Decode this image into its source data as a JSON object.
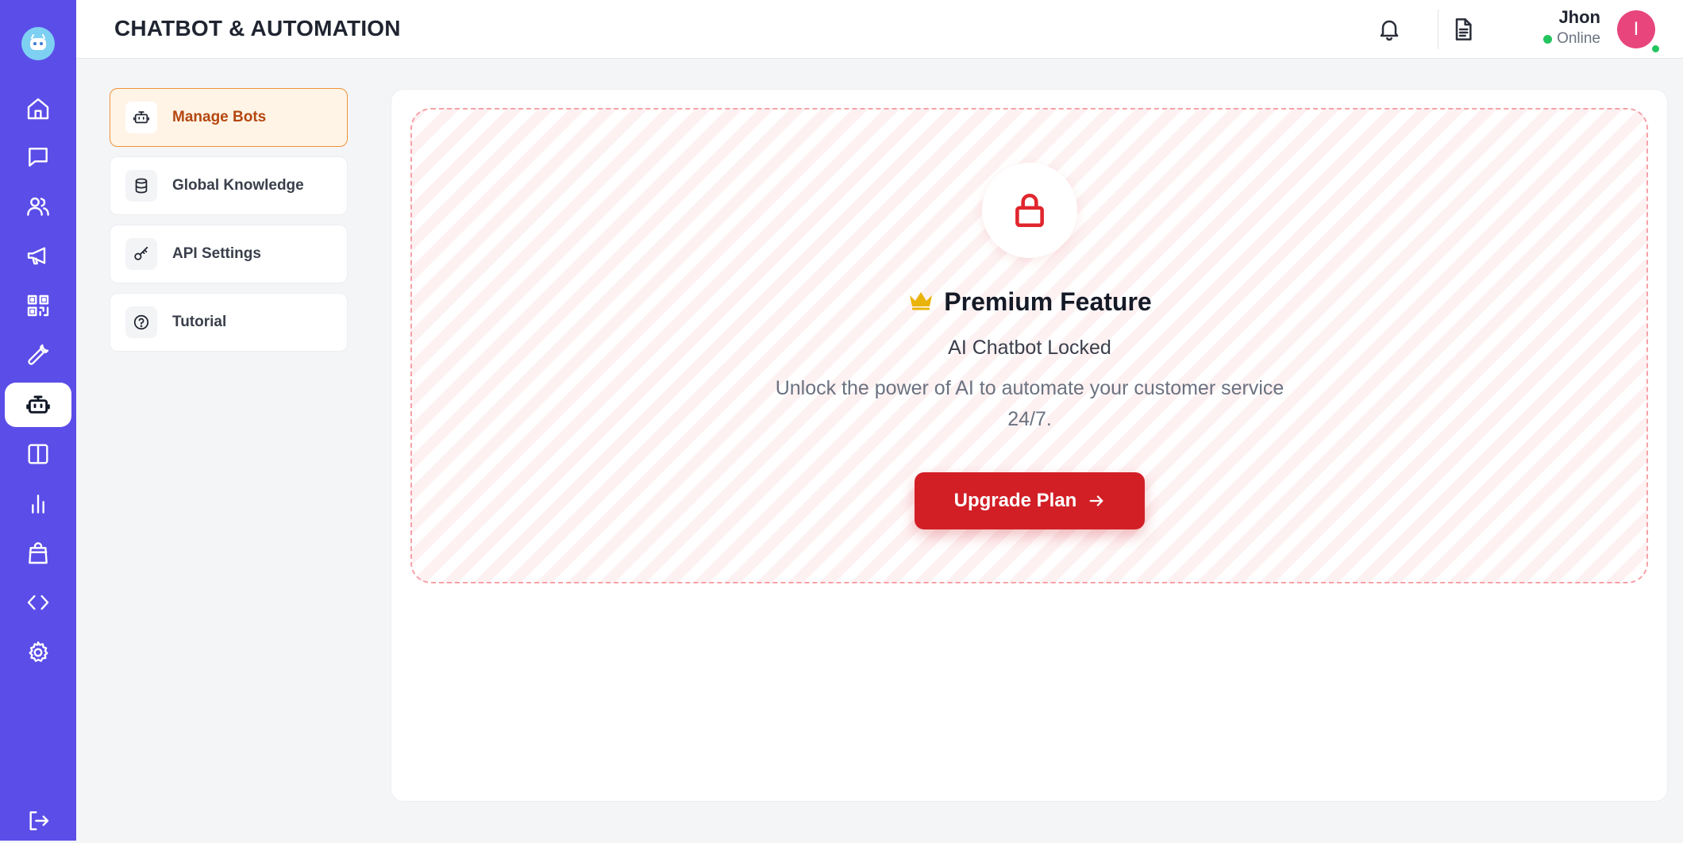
{
  "header": {
    "title": "CHATBOT & AUTOMATION",
    "notification_icon": "bell-icon",
    "document_icon": "document-icon",
    "user": {
      "name": "Jhon",
      "status": "Online",
      "avatar_letter": "I",
      "avatar_color": "#e8457c"
    }
  },
  "rail": {
    "background": "#5b4de8",
    "items": [
      {
        "icon": "home-icon"
      },
      {
        "icon": "chat-icon"
      },
      {
        "icon": "users-icon"
      },
      {
        "icon": "megaphone-icon"
      },
      {
        "icon": "qr-code-icon"
      },
      {
        "icon": "wrench-icon"
      },
      {
        "icon": "bot-icon",
        "active": true
      },
      {
        "icon": "columns-icon"
      },
      {
        "icon": "bar-chart-icon"
      },
      {
        "icon": "shopping-bag-icon"
      },
      {
        "icon": "code-icon"
      },
      {
        "icon": "settings-icon"
      },
      {
        "icon": "logout-icon"
      }
    ]
  },
  "subnav": {
    "items": [
      {
        "label": "Manage Bots",
        "icon": "bot-icon",
        "active": true
      },
      {
        "label": "Global Knowledge",
        "icon": "database-icon"
      },
      {
        "label": "API Settings",
        "icon": "key-icon"
      },
      {
        "label": "Tutorial",
        "icon": "help-circle-icon"
      }
    ]
  },
  "locked": {
    "title": "Premium Feature",
    "subtitle": "AI Chatbot Locked",
    "description": "Unlock the power of AI to automate your customer service 24/7.",
    "button_label": "Upgrade Plan",
    "accent": "#d21f26"
  }
}
